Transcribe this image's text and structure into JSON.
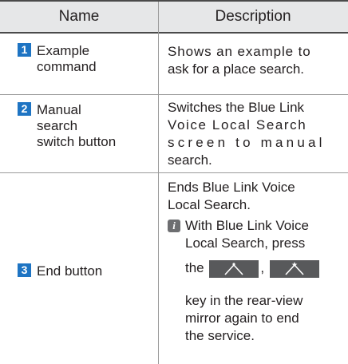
{
  "header": {
    "name": "Name",
    "description": "Description"
  },
  "rows": [
    {
      "number": "1",
      "name_lines": [
        "Example",
        "command"
      ],
      "desc_lines": [
        "Shows an example to",
        "ask for a place search."
      ]
    },
    {
      "number": "2",
      "name_lines": [
        "Manual",
        "search",
        "switch button"
      ],
      "desc_lines": [
        "Switches the Blue Link",
        "Voice Local Search",
        "screen to manual",
        "search."
      ]
    },
    {
      "number": "3",
      "name_lines": [
        "End button"
      ],
      "desc_lines": [
        "Ends Blue Link Voice",
        "Local Search."
      ],
      "note": {
        "icon": "info-icon",
        "lines": [
          "With Blue Link Voice",
          "Local Search, press"
        ],
        "before_keys": "the",
        "between_keys": ",",
        "after_lines": [
          "key in the rear-view",
          "mirror again to end",
          "the service."
        ]
      }
    }
  ],
  "keys": [
    {
      "icon": "voice-key-icon"
    },
    {
      "icon": "voice-end-key-icon"
    }
  ],
  "colors": {
    "header_bg": "#e6e7e8",
    "badge": "#1e74c3",
    "key_bg": "#58595b",
    "info_icon": "#6d6e71"
  }
}
